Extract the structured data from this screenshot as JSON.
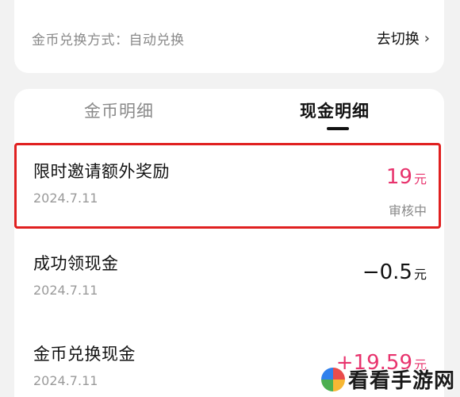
{
  "exchange": {
    "label": "金币兑换方式：自动兑换",
    "switch_label": "去切换",
    "chevron": "›"
  },
  "tabs": {
    "coin": "金币明细",
    "cash": "现金明细",
    "active": "cash"
  },
  "records": [
    {
      "title": "限时邀请额外奖励",
      "date": "2024.7.11",
      "amount": "19",
      "unit": "元",
      "status": "审核中",
      "highlighted": true
    },
    {
      "title": "成功领现金",
      "date": "2024.7.11",
      "amount": "−0.5",
      "unit": "元",
      "status": ""
    },
    {
      "title": "金币兑换现金",
      "date": "2024.7.11",
      "amount": "+19.59",
      "unit": "元",
      "status": ""
    }
  ],
  "colors": {
    "positive": "#e8336d",
    "highlight_border": "#e02020"
  },
  "watermark": {
    "text": "看看手游网",
    "icon": "game-site-logo-icon"
  }
}
